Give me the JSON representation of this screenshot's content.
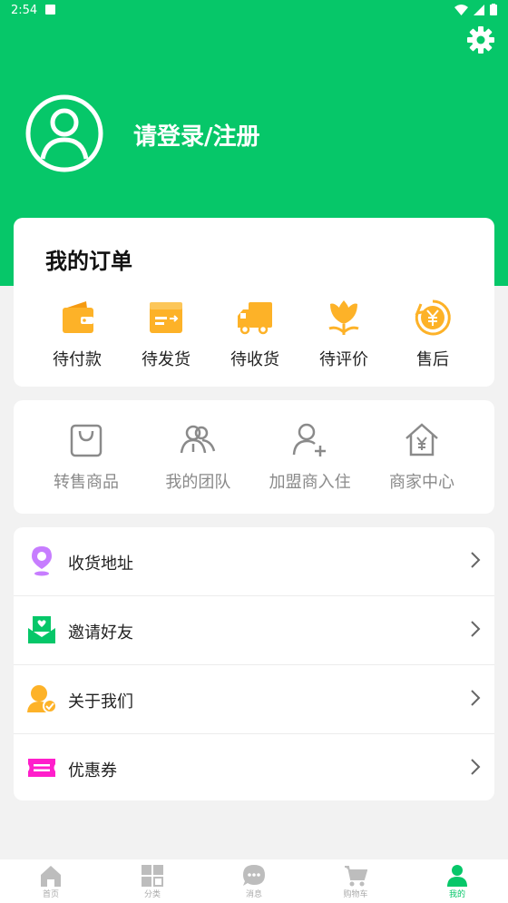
{
  "status_bar": {
    "time": "2:54"
  },
  "colors": {
    "brand": "#06c769",
    "order_icon": "#fdb228",
    "tool_icon": "#8a8a8a"
  },
  "profile": {
    "login_label": "请登录/注册",
    "avatar_icon": "user-circle-icon",
    "settings_icon": "gear-icon"
  },
  "orders": {
    "title": "我的订单",
    "items": [
      {
        "label": "待付款",
        "icon": "wallet-icon"
      },
      {
        "label": "待发货",
        "icon": "box-icon"
      },
      {
        "label": "待收货",
        "icon": "truck-icon"
      },
      {
        "label": "待评价",
        "icon": "flower-icon"
      },
      {
        "label": "售后",
        "icon": "yuan-refund-icon"
      }
    ]
  },
  "tools": {
    "items": [
      {
        "label": "转售商品",
        "icon": "bag-icon"
      },
      {
        "label": "我的团队",
        "icon": "team-icon"
      },
      {
        "label": "加盟商入住",
        "icon": "add-user-icon"
      },
      {
        "label": "商家中心",
        "icon": "home-yuan-icon"
      }
    ]
  },
  "menu": {
    "items": [
      {
        "label": "收货地址",
        "icon": "location-pin-icon",
        "color": "#c77dff"
      },
      {
        "label": "邀请好友",
        "icon": "invite-envelope-icon",
        "color": "#06c769"
      },
      {
        "label": "关于我们",
        "icon": "about-user-icon",
        "color": "#fdb228"
      },
      {
        "label": "优惠券",
        "icon": "coupon-icon",
        "color": "#ff1ecb"
      }
    ]
  },
  "tabbar": {
    "items": [
      {
        "label": "首页",
        "icon": "home-icon"
      },
      {
        "label": "分类",
        "icon": "grid-icon"
      },
      {
        "label": "消息",
        "icon": "chat-icon"
      },
      {
        "label": "购物车",
        "icon": "cart-icon"
      },
      {
        "label": "我的",
        "icon": "person-icon"
      }
    ],
    "active_index": 4
  }
}
